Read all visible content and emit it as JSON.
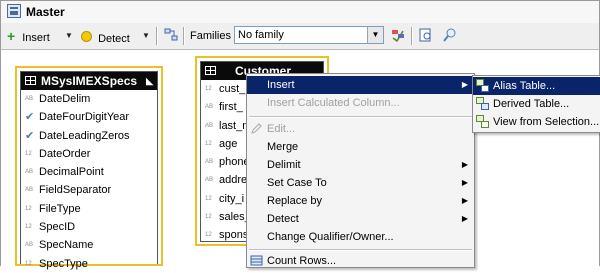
{
  "window": {
    "title": "Master"
  },
  "toolbar": {
    "insert_label": "Insert",
    "detect_label": "Detect",
    "families_label": "Families",
    "families_value": "No family"
  },
  "tables": [
    {
      "name": "MSysIMEXSpecs",
      "columns": [
        {
          "type": "AB",
          "name": "DateDelim"
        },
        {
          "type": "check",
          "name": "DateFourDigitYear"
        },
        {
          "type": "check",
          "name": "DateLeadingZeros"
        },
        {
          "type": "12",
          "name": "DateOrder"
        },
        {
          "type": "AB",
          "name": "DecimalPoint"
        },
        {
          "type": "AB",
          "name": "FieldSeparator"
        },
        {
          "type": "12",
          "name": "FileType"
        },
        {
          "type": "12",
          "name": "SpecID"
        },
        {
          "type": "AB",
          "name": "SpecName"
        },
        {
          "type": "12",
          "name": "SpecType"
        }
      ]
    },
    {
      "name": "Customer",
      "columns": [
        {
          "type": "12",
          "name": "cust_"
        },
        {
          "type": "AB",
          "name": "first_"
        },
        {
          "type": "AB",
          "name": "last_n"
        },
        {
          "type": "12",
          "name": "age"
        },
        {
          "type": "AB",
          "name": "phone"
        },
        {
          "type": "AB",
          "name": "addre"
        },
        {
          "type": "12",
          "name": "city_i"
        },
        {
          "type": "12",
          "name": "sales_"
        },
        {
          "type": "12",
          "name": "spons"
        }
      ]
    }
  ],
  "context_menu": {
    "items": [
      {
        "label": "Insert",
        "submenu": true,
        "selected": true
      },
      {
        "label": "Insert Calculated Column...",
        "disabled": true
      },
      {
        "separator": true
      },
      {
        "label": "Edit...",
        "disabled": true,
        "icon": "pencil-icon"
      },
      {
        "label": "Merge"
      },
      {
        "label": "Delimit",
        "submenu": true
      },
      {
        "label": "Set Case To",
        "submenu": true
      },
      {
        "label": "Replace by",
        "submenu": true
      },
      {
        "label": "Detect",
        "submenu": true
      },
      {
        "label": "Change Qualifier/Owner..."
      },
      {
        "separator": true
      },
      {
        "label": "Count Rows...",
        "icon": "count-rows-icon"
      }
    ]
  },
  "submenu": {
    "items": [
      {
        "label": "Alias Table...",
        "selected": true,
        "icon": "alias-table-icon"
      },
      {
        "label": "Derived Table...",
        "icon": "derived-table-icon"
      },
      {
        "label": "View from Selection...",
        "icon": "view-selection-icon"
      }
    ]
  },
  "colors": {
    "selection": "#0a246a",
    "table_header": "#0a0a0a",
    "table_border": "#e8c228"
  }
}
